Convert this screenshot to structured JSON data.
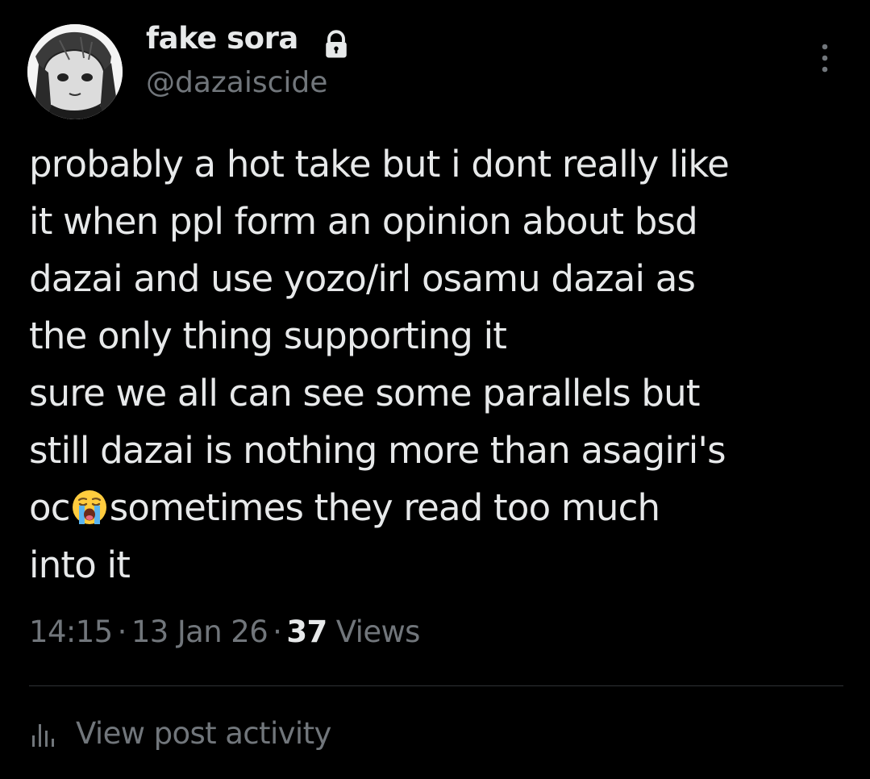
{
  "author": {
    "display_name": "fake sora",
    "handle": "@dazaiscide",
    "protected_icon": "lock-icon",
    "avatar_icon": "avatar"
  },
  "post": {
    "lines": [
      "probably a hot take but i dont really like",
      "it when ppl form an opinion about bsd",
      "dazai and use yozo/irl osamu dazai as",
      "the only thing supporting it",
      "sure we all can see some parallels but",
      "still dazai is nothing more than asagiri's"
    ],
    "line7_before_emoji": "oc",
    "emoji": "loudly-crying-face-emoji",
    "line7_after_emoji": "sometimes they read too much",
    "line8": "into it"
  },
  "meta": {
    "time": "14:15",
    "separator": "·",
    "date": "13 Jan 26",
    "views_count": "37",
    "views_label": "Views"
  },
  "actions": {
    "more_icon": "more-vertical-icon",
    "view_activity_label": "View post activity",
    "view_activity_icon": "bar-chart-icon"
  },
  "colors": {
    "background": "#000000",
    "primary_text": "#e7e9ea",
    "secondary_text": "#71767b",
    "divider": "#2f3336"
  }
}
